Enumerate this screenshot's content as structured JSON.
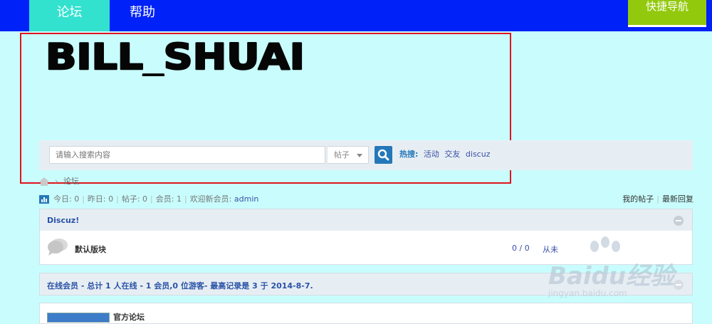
{
  "nav": {
    "forum": "论坛",
    "help": "帮助",
    "quick_nav": "快捷导航"
  },
  "logo": {
    "text": "BILL_SHUAI"
  },
  "search": {
    "placeholder": "请输入搜索内容",
    "type": "帖子",
    "hot_label": "热搜:",
    "hot_links": [
      "活动",
      "交友",
      "discuz"
    ]
  },
  "breadcrumb": {
    "current": "论坛"
  },
  "stats": {
    "today": "今日: 0",
    "yesterday": "昨日: 0",
    "posts": "帖子: 0",
    "members": "会员: 1",
    "welcome": "欢迎新会员:",
    "new_member": "admin"
  },
  "user_links": {
    "my_posts": "我的帖子",
    "latest_replies": "最新回复"
  },
  "category": {
    "title": "Discuz!",
    "forum": {
      "name": "默认版块",
      "count": "0 / 0",
      "last": "从未"
    }
  },
  "online": {
    "text": "在线会员 - 总计 1 人在线 - 1 会员,0 位游客- 最高记录是 3 于 2014-8-7."
  },
  "friend_links": {
    "name": "官方论坛"
  },
  "watermark": {
    "text": "Baidu经验",
    "url": "jingyan.baidu.com"
  },
  "colors": {
    "nav_bg": "#0021f8",
    "forum_tab": "#33e1cf",
    "quick_nav": "#92c90c",
    "page_bg": "#c9fdfd",
    "highlight": "#e0141d",
    "search_btn": "#2478b9"
  }
}
